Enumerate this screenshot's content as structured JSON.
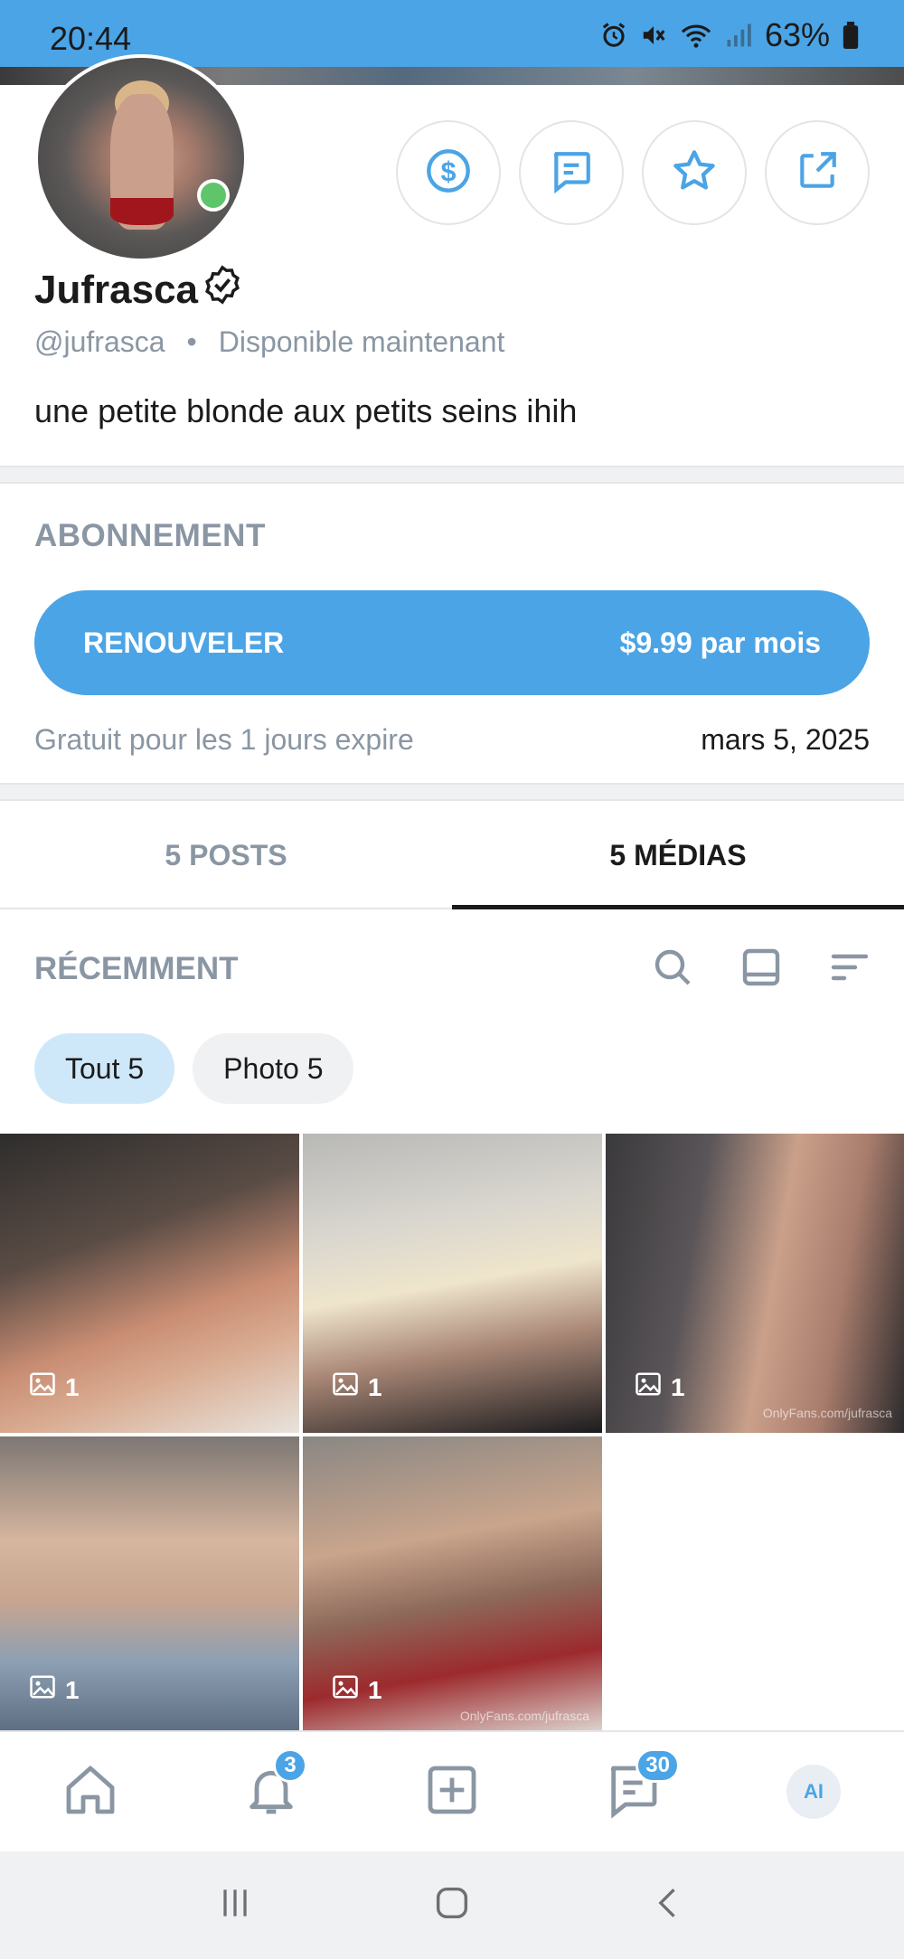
{
  "status_bar": {
    "time": "20:44",
    "battery": "63%"
  },
  "profile": {
    "name": "Jufrasca",
    "handle": "@jufrasca",
    "availability": "Disponible maintenant",
    "bio": "une petite blonde aux petits seins ihih"
  },
  "actions": [
    {
      "icon": "dollar-icon"
    },
    {
      "icon": "message-icon"
    },
    {
      "icon": "star-icon"
    },
    {
      "icon": "share-icon"
    }
  ],
  "subscription": {
    "title": "ABONNEMENT",
    "renew_label": "RENOUVELER",
    "price_label": "$9.99 par mois",
    "expire_text": "Gratuit pour les 1 jours expire",
    "expire_date": "mars 5, 2025"
  },
  "tabs": [
    {
      "label": "5 POSTS",
      "active": false
    },
    {
      "label": "5 MÉDIAS",
      "active": true
    }
  ],
  "recent": {
    "title": "RÉCEMMENT"
  },
  "filters": [
    {
      "label": "Tout 5",
      "active": true
    },
    {
      "label": "Photo 5",
      "active": false
    }
  ],
  "media": [
    {
      "count": "1"
    },
    {
      "count": "1"
    },
    {
      "count": "1",
      "watermark": "OnlyFans.com/jufrasca"
    },
    {
      "count": "1"
    },
    {
      "count": "1",
      "watermark": "OnlyFans.com/jufrasca"
    }
  ],
  "bottom_nav": {
    "notifications_badge": "3",
    "messages_badge": "30",
    "ai_label": "AI"
  },
  "colors": {
    "accent": "#4ba4e6",
    "online": "#5ec56b",
    "muted": "#8a96a3"
  }
}
